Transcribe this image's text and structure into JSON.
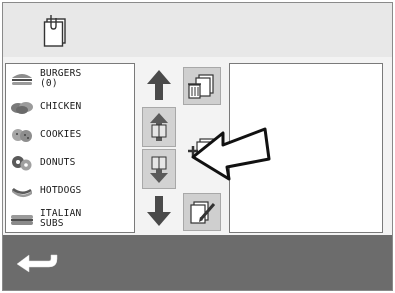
{
  "categories": [
    {
      "label": "BURGERS\n(0)",
      "icon": "burger-thumbnail"
    },
    {
      "label": "CHICKEN",
      "icon": "chicken-thumbnail"
    },
    {
      "label": "COOKIES",
      "icon": "cookies-thumbnail"
    },
    {
      "label": "DONUTS",
      "icon": "donuts-thumbnail"
    },
    {
      "label": "HOTDOGS",
      "icon": "hotdog-thumbnail"
    },
    {
      "label": "ITALIAN\nSUBS",
      "icon": "italian-sub-thumbnail"
    }
  ],
  "icons": {
    "header": "clipboard-icon",
    "move_up": "arrow-up-icon",
    "move_down": "arrow-down-icon",
    "delete": "trash-note-icon",
    "add": "add-note-icon",
    "edit": "edit-note-icon",
    "back": "back-arrow-icon"
  },
  "colors": {
    "header_bg": "#e8e8e8",
    "footer_bg": "#6c6c6c",
    "button_bg": "#cfcfcf"
  }
}
